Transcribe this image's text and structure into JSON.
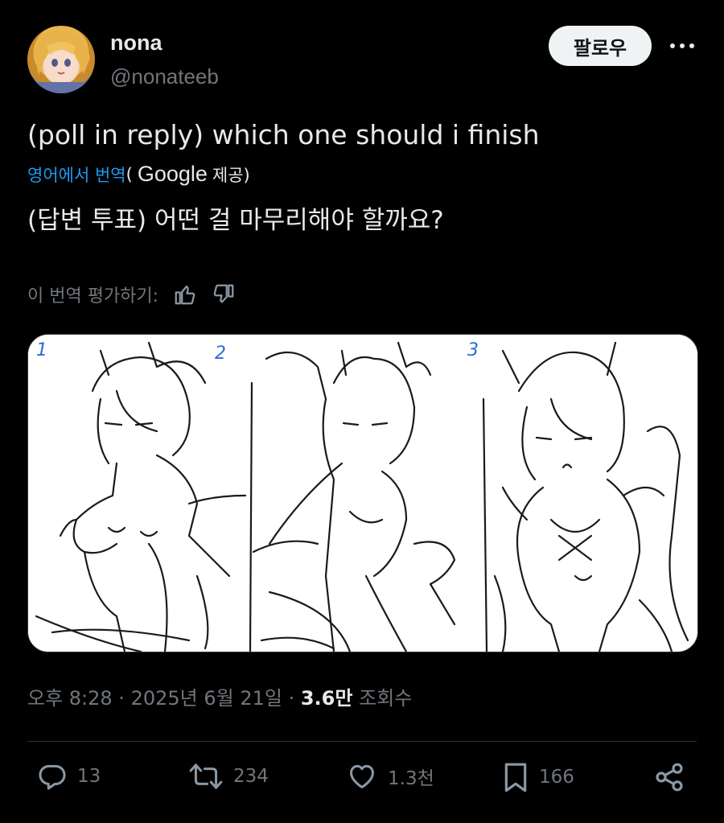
{
  "author": {
    "name": "nona",
    "handle": "@nonateeb",
    "avatar": "avatar-image"
  },
  "header": {
    "follow_label": "팔로우",
    "more_icon": "more-dots-icon"
  },
  "post": {
    "text": "(poll in reply) which one should i finish",
    "translation": {
      "link_label": "영어에서 번역",
      "paren_open": "(",
      "provider": "Google",
      "provided_suffix": "제공)",
      "text": "(답변 투표) 어떤 걸 마무리해야 할까요?",
      "rate_label": "이 번역 평가하기:"
    },
    "timestamp": "오후 8:28 · 2025년 6월 21일 ·",
    "views_value": "3.6만",
    "views_label": "조회수"
  },
  "media": {
    "panel_numbers": [
      "1",
      "2",
      "3"
    ]
  },
  "actions": {
    "replies": "13",
    "reposts": "234",
    "likes": "1.3천",
    "bookmarks": "166"
  },
  "colors": {
    "background": "#000000",
    "text": "#e7e9ea",
    "muted": "#71767b",
    "link": "#1d9bf0",
    "button_bg": "#eff3f4"
  }
}
